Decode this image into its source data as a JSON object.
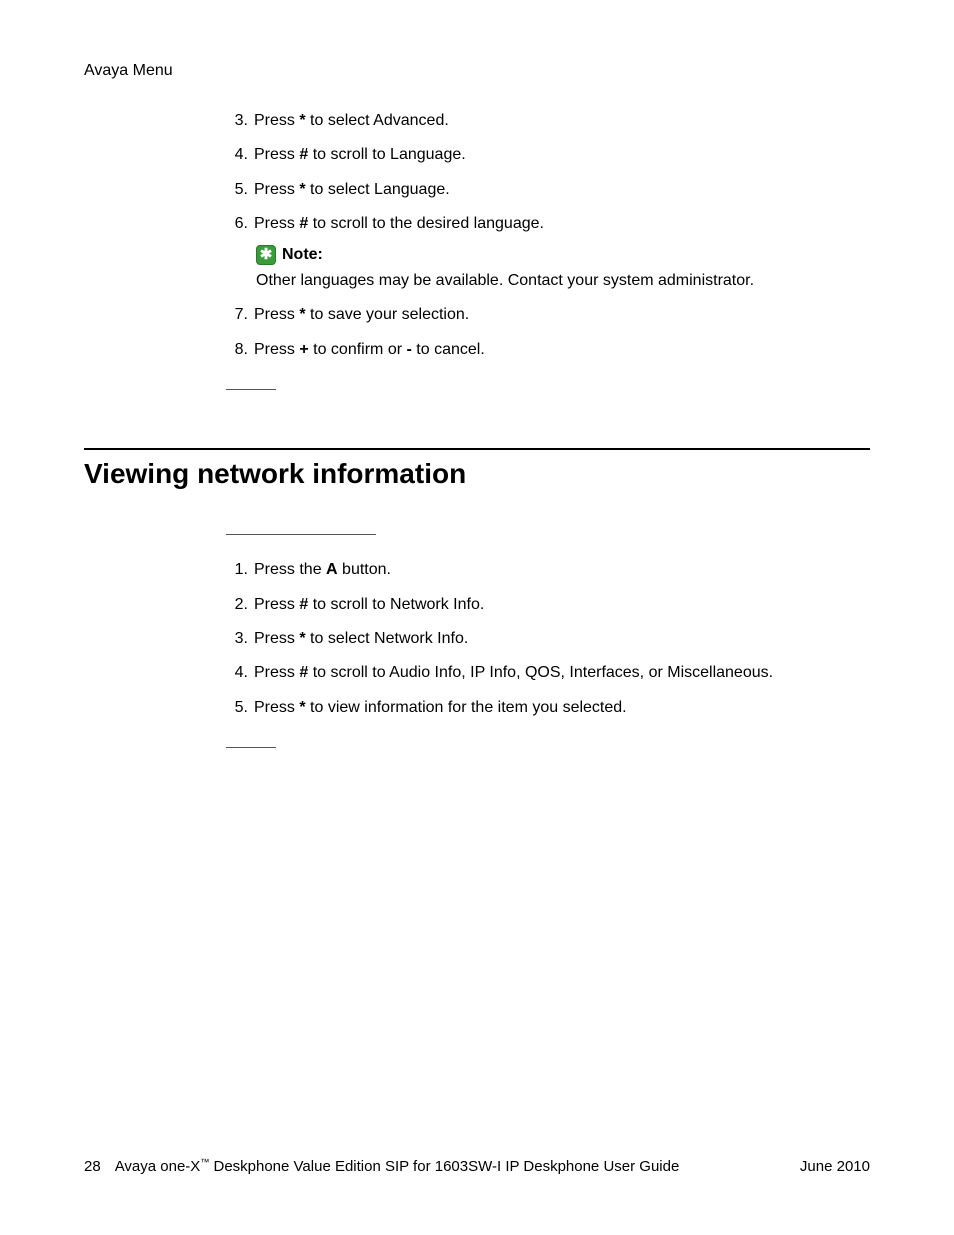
{
  "header": {
    "title": "Avaya Menu"
  },
  "steps_top": [
    {
      "num": "3.",
      "pre": "Press ",
      "key": "*",
      "post": " to select Advanced."
    },
    {
      "num": "4.",
      "pre": "Press ",
      "key": "#",
      "post": " to scroll to Language."
    },
    {
      "num": "5.",
      "pre": "Press ",
      "key": "*",
      "post": " to select Language."
    },
    {
      "num": "6.",
      "pre": "Press ",
      "key": "#",
      "post": " to scroll to the desired language."
    }
  ],
  "note": {
    "icon": "✱",
    "label": "Note:",
    "body": "Other languages may be available. Contact your system administrator."
  },
  "steps_top2": [
    {
      "num": "7.",
      "pre": "Press ",
      "key": "*",
      "post": " to save your selection."
    },
    {
      "num": "8.",
      "pre": "Press ",
      "key": "+",
      "mid": " to confirm or ",
      "key2": "-",
      "post": " to cancel."
    }
  ],
  "section": {
    "title": "Viewing network information"
  },
  "steps_bottom": [
    {
      "num": "1.",
      "pre": "Press the ",
      "key": "A",
      "post": " button."
    },
    {
      "num": "2.",
      "pre": "Press ",
      "key": "#",
      "post": " to scroll to Network Info."
    },
    {
      "num": "3.",
      "pre": "Press ",
      "key": "*",
      "post": " to select Network Info."
    },
    {
      "num": "4.",
      "pre": "Press ",
      "key": "#",
      "post": " to scroll to Audio Info, IP Info, QOS, Interfaces, or Miscellaneous."
    },
    {
      "num": "5.",
      "pre": "Press ",
      "key": "*",
      "post": " to view information for the item you selected."
    }
  ],
  "footer": {
    "page": "28",
    "product_pre": "Avaya one-X",
    "tm": "™",
    "product_post": " Deskphone Value Edition SIP for 1603SW-I IP Deskphone User Guide",
    "date": "June 2010"
  }
}
